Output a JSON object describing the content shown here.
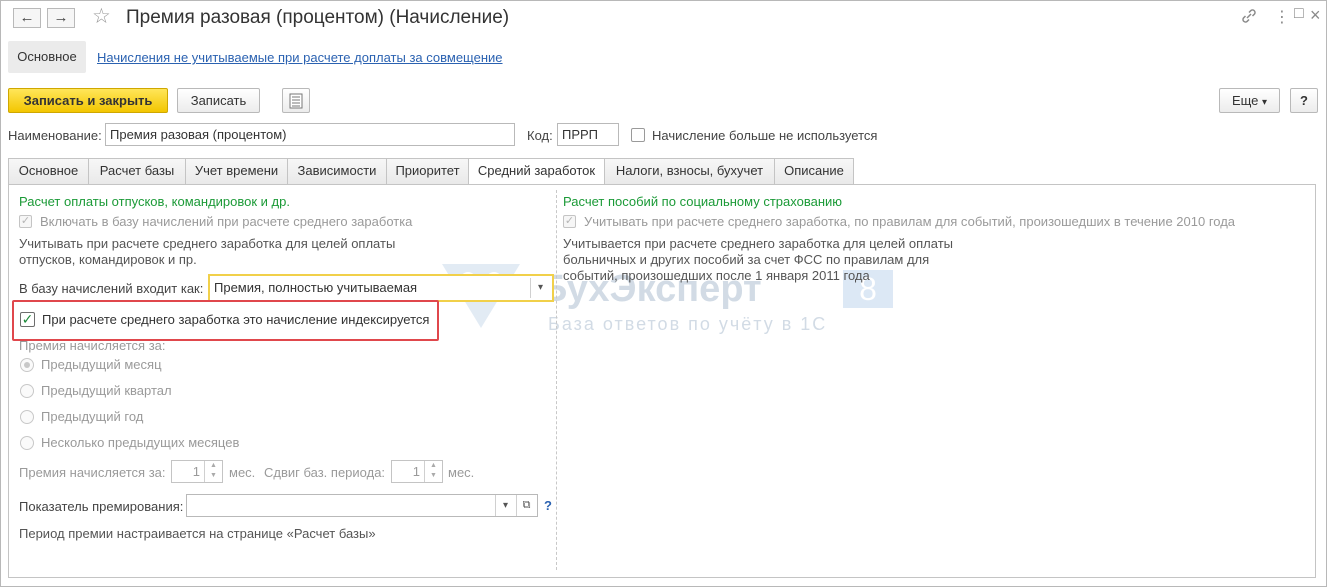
{
  "window": {
    "title": "Премия разовая (процентом) (Начисление)",
    "back_icon": "←",
    "forward_icon": "→",
    "star_icon": "☆",
    "link_icon": "🔗",
    "menu_icon": "⋮",
    "maximize_icon": "□",
    "close_icon": "×"
  },
  "sections": {
    "main": "Основное",
    "link": "Начисления не учитываемые при расчете доплаты за совмещение"
  },
  "toolbar": {
    "save_close": "Записать и закрыть",
    "save": "Записать",
    "more": "Еще",
    "more_arrow": "▾",
    "help": "?"
  },
  "fields": {
    "name_label": "Наименование:",
    "name_value": "Премия разовая (процентом)",
    "code_label": "Код:",
    "code_value": "ПРРП",
    "unused_label": "Начисление больше не используется"
  },
  "tabs": [
    "Основное",
    "Расчет базы",
    "Учет времени",
    "Зависимости",
    "Приоритет",
    "Средний заработок",
    "Налоги, взносы, бухучет",
    "Описание"
  ],
  "left": {
    "heading": "Расчет оплаты отпусков, командировок и др.",
    "include_label": "Включать в базу начислений при расчете среднего заработка",
    "note_line1": "Учитывать при расчете среднего заработка для целей оплаты",
    "note_line2": "отпусков, командировок и пр.",
    "base_label": "В базу начислений входит как:",
    "base_value": "Премия, полностью учитываемая",
    "indexed_label": "При расчете среднего заработка это начисление индексируется",
    "period_heading": "Премия начисляется за:",
    "radios": [
      "Предыдущий месяц",
      "Предыдущий квартал",
      "Предыдущий год",
      "Несколько предыдущих месяцев"
    ],
    "months_label": "Премия начисляется за:",
    "months_value": "1",
    "months_unit": "мес.",
    "shift_label": "Сдвиг баз. периода:",
    "shift_value": "1",
    "shift_unit": "мес.",
    "indicator_label": "Показатель премирования:",
    "indicator_help": "?",
    "footer_note": "Период премии настраивается на странице «Расчет базы»"
  },
  "right": {
    "heading": "Расчет пособий по социальному страхованию",
    "include_label": "Учитывать при расчете среднего заработка, по правилам для событий, произошедших в течение 2010 года",
    "note_line1": "Учитывается при расчете среднего заработка для целей оплаты",
    "note_line2": "больничных и других пособий за счет ФСС по правилам для",
    "note_line3": "событий, произошедших после 1 января 2011 года"
  },
  "watermark": {
    "brand": "БухЭксперт",
    "badge": "8",
    "tagline": "База ответов по учёту в 1С"
  },
  "colors": {
    "accent_yellow": "#f3c600",
    "link_blue": "#2b62b1",
    "section_green": "#1b9a37",
    "highlight_red": "#e0474c"
  }
}
